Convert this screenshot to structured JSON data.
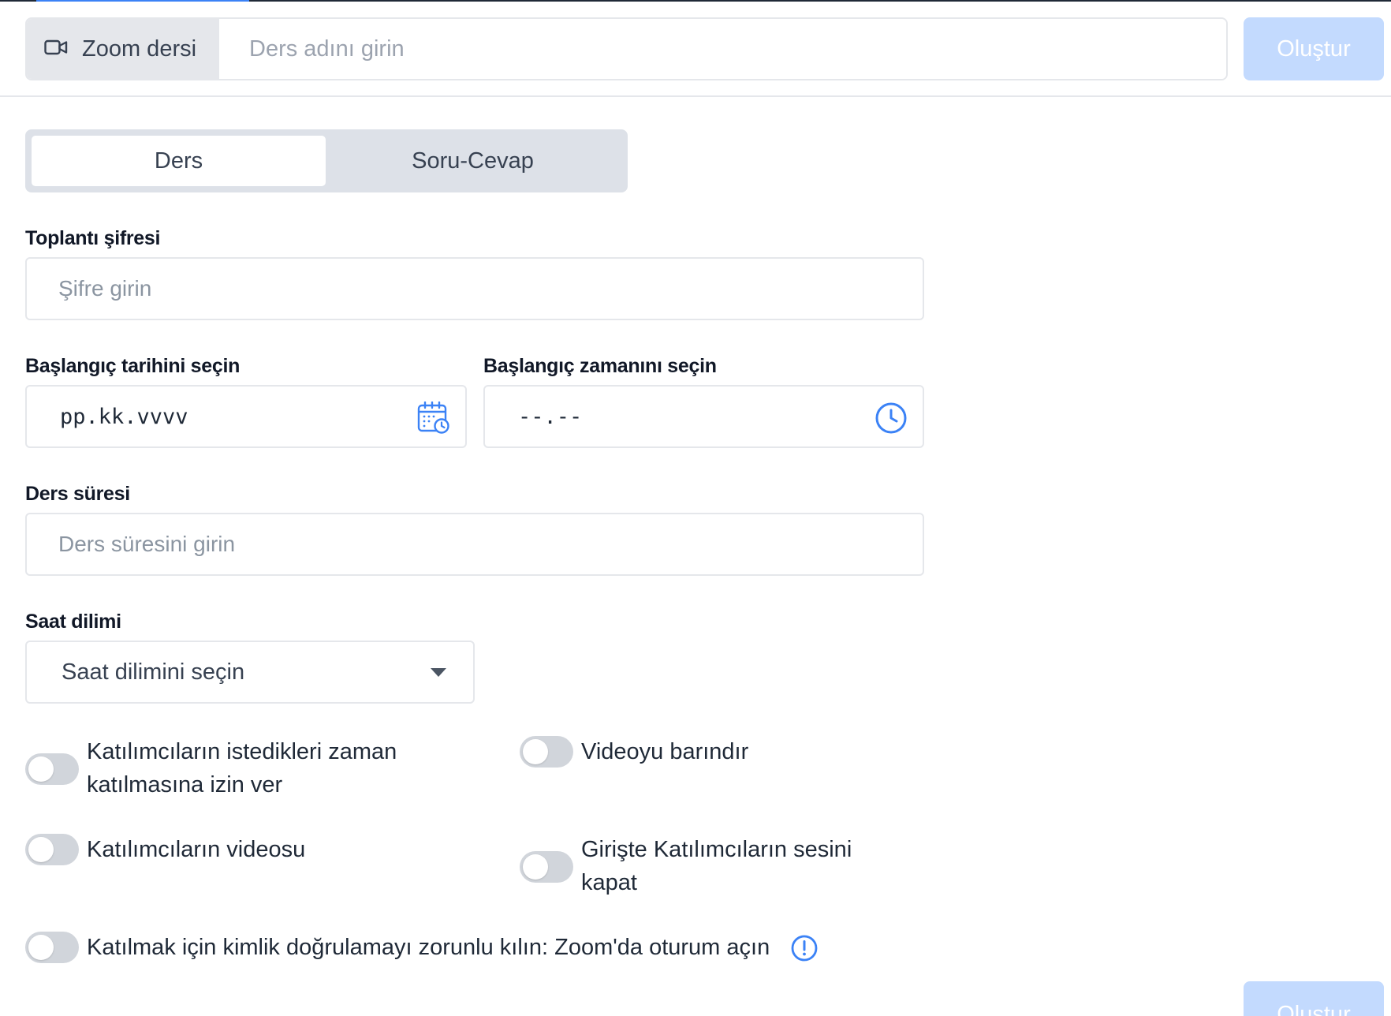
{
  "header": {
    "addon_label": "Zoom dersi",
    "addon_icon": "video-camera-icon",
    "lesson_name_placeholder": "Ders adını girin",
    "create_label": "Oluştur"
  },
  "tabs": [
    {
      "label": "Ders",
      "active": true
    },
    {
      "label": "Soru-Cevap",
      "active": false
    }
  ],
  "form": {
    "password": {
      "label": "Toplantı şifresi",
      "placeholder": "Şifre girin"
    },
    "start_date": {
      "label": "Başlangıç tarihini seçin",
      "value": "pp.kk.vvvv",
      "icon": "calendar-clock-icon"
    },
    "start_time": {
      "label": "Başlangıç zamanını seçin",
      "value": "--.--",
      "icon": "clock-icon"
    },
    "duration": {
      "label": "Ders süresi",
      "placeholder": "Ders süresini girin"
    },
    "timezone": {
      "label": "Saat dilimi",
      "selected": "Saat dilimini seçin"
    }
  },
  "toggles": {
    "join_anytime": {
      "line1": "Katılımcıların istedikleri zaman",
      "line2": "katılmasına izin ver",
      "on": false
    },
    "host_video": {
      "label": "Videoyu barındır",
      "on": false
    },
    "participant_video": {
      "label": "Katılımcıların videosu",
      "on": false
    },
    "mute_on_entry": {
      "line1": "Girişte Katılımcıların sesini",
      "line2": "kapat",
      "on": false
    },
    "auth_required": {
      "label": "Katılmak için kimlik doğrulamayı zorunlu kılın: Zoom'da oturum açın",
      "on": false,
      "info_icon": "info-alert-icon"
    }
  },
  "footer": {
    "create_label": "Oluştur"
  },
  "colors": {
    "accent": "#3b82f6",
    "disabled_button": "#c3dafe",
    "border": "#e5e7eb",
    "toggle_off": "#d1d5db"
  }
}
